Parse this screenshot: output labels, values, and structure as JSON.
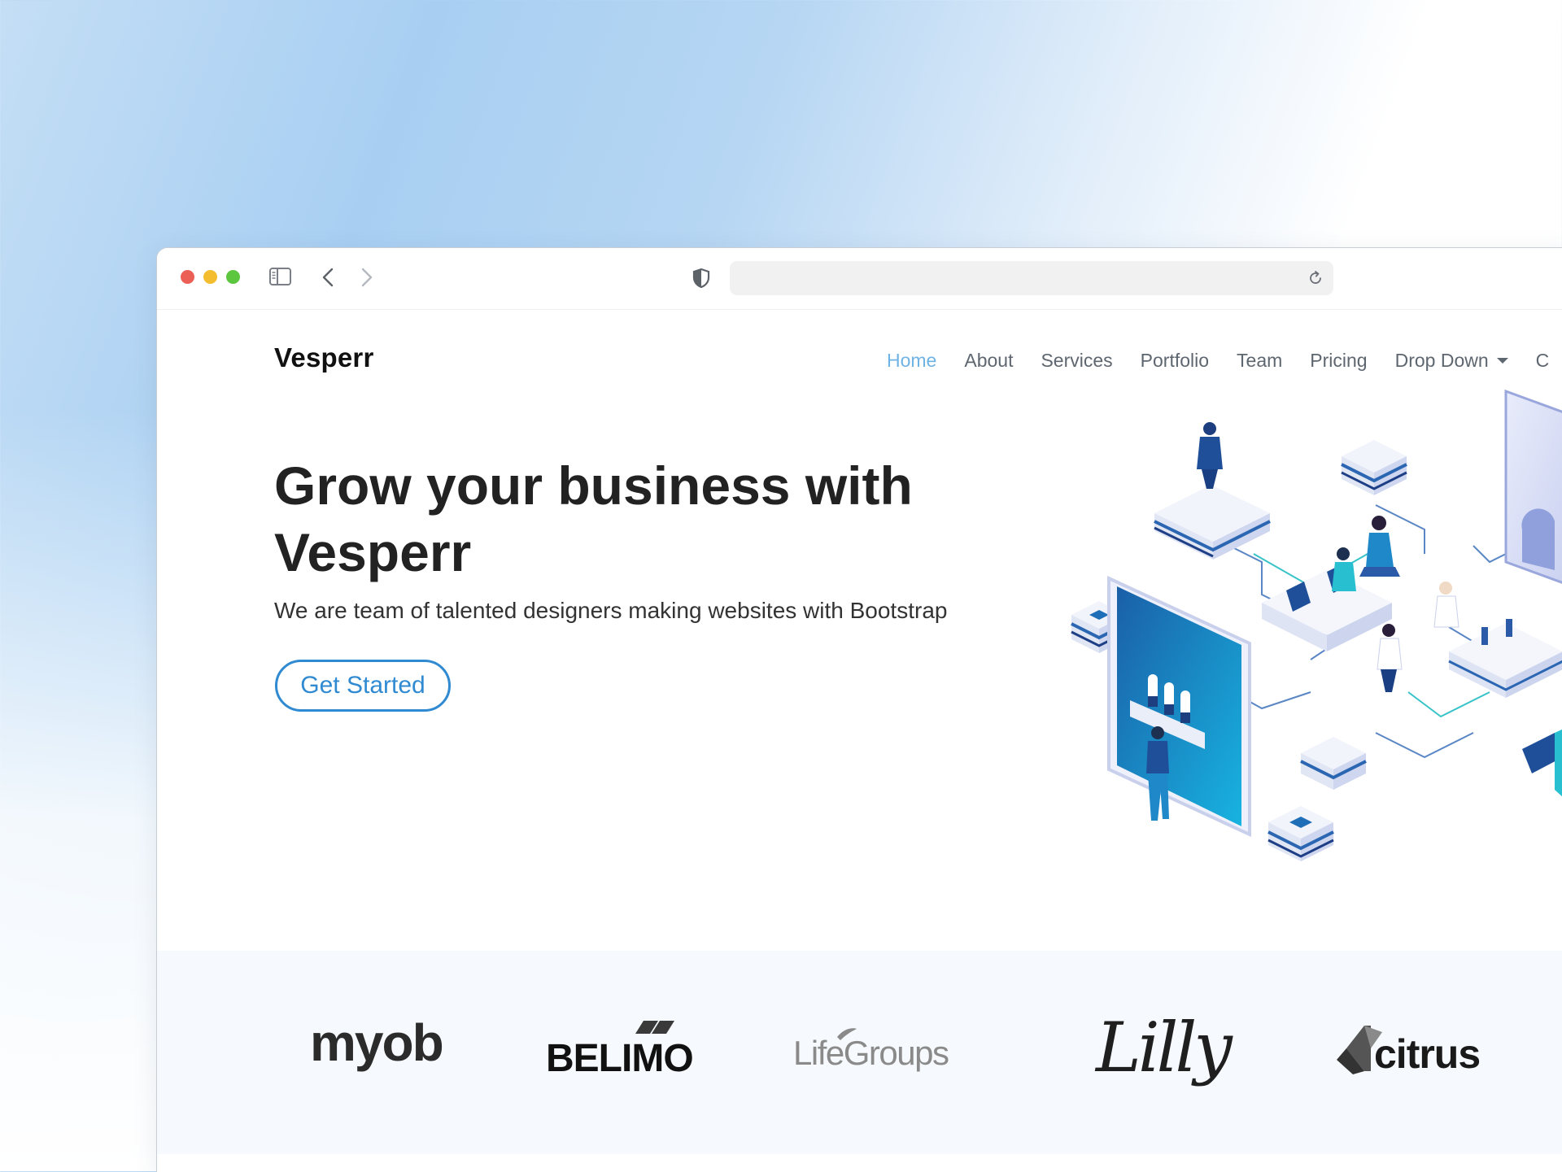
{
  "browser": {
    "url": "",
    "controls": {
      "sidebar_icon": "sidebar-icon",
      "back_icon": "chevron-left-icon",
      "forward_icon": "chevron-right-icon",
      "privacy_icon": "shield-icon",
      "reload_icon": "reload-icon"
    }
  },
  "site": {
    "logo": "Vesperr",
    "nav": [
      {
        "label": "Home",
        "active": true
      },
      {
        "label": "About"
      },
      {
        "label": "Services"
      },
      {
        "label": "Portfolio"
      },
      {
        "label": "Team"
      },
      {
        "label": "Pricing"
      },
      {
        "label": "Drop Down",
        "has_dropdown": true
      },
      {
        "label": "C"
      }
    ],
    "hero": {
      "title": "Grow your business with Vesperr",
      "subtitle": "We are team of talented designers making websites with Bootstrap",
      "cta": "Get Started"
    },
    "clients": [
      "myob",
      "BELIMO",
      "LifeGroups",
      "Lilly",
      "citrus"
    ]
  },
  "colors": {
    "accent": "#2f8ad2",
    "nav_active": "#6fb3e4",
    "clients_bg": "#f6f9fd"
  }
}
